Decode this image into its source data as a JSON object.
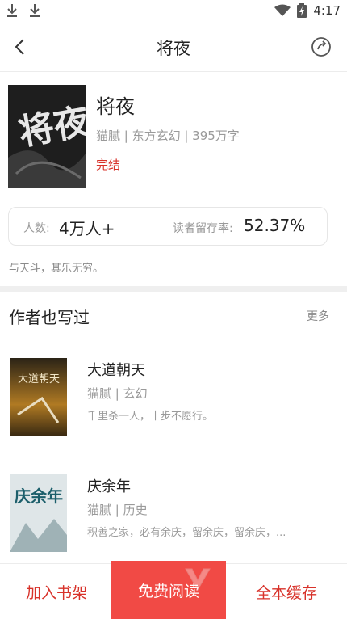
{
  "status_bar": {
    "time": "4:17"
  },
  "header": {
    "title": "将夜"
  },
  "book": {
    "title": "将夜",
    "cover_text": "将夜",
    "meta": "猫腻 | 东方玄幻 | 395万字",
    "status": "完结"
  },
  "stats": {
    "readers_label": "人数:",
    "readers_value": "4万人+",
    "retention_label": "读者留存率:",
    "retention_value": "52.37%"
  },
  "slogan": "与天斗，其乐无穷。",
  "author_section": {
    "title": "作者也写过",
    "more": "更多",
    "items": [
      {
        "title": "大道朝天",
        "meta": "猫腻 | 玄幻",
        "desc": "千里杀一人，十步不愿行。",
        "cover_text": "大道朝天"
      },
      {
        "title": "庆余年",
        "meta": "猫腻 | 历史",
        "desc": "积善之家，必有余庆，留余庆，留余庆，...",
        "cover_text": "庆余年"
      }
    ]
  },
  "bottom_bar": {
    "add_shelf": "加入书架",
    "free_read": "免费阅读",
    "cache_all": "全本缓存"
  },
  "colors": {
    "accent": "#d8322a",
    "primary_button": "#f14a45"
  }
}
